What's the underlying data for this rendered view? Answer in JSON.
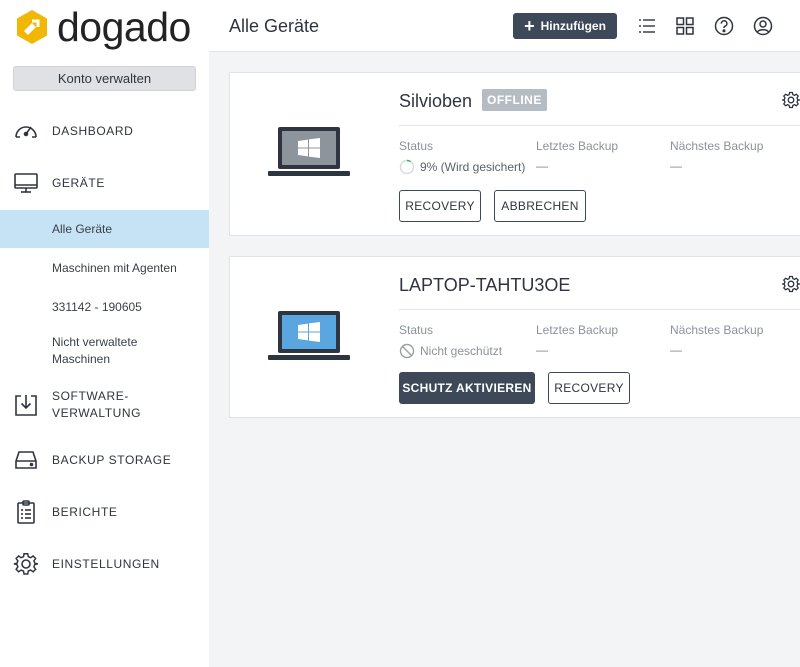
{
  "brand": {
    "name": "dogado",
    "accent": "#f2b705"
  },
  "sidebar": {
    "account_button": "Konto verwalten",
    "items": [
      {
        "label": "DASHBOARD",
        "icon": "speedometer-icon"
      },
      {
        "label": "GERÄTE",
        "icon": "monitor-icon"
      },
      {
        "label": "SOFTWARE-",
        "label2": "VERWALTUNG",
        "icon": "software-download-icon"
      },
      {
        "label": "BACKUP STORAGE",
        "icon": "storage-drive-icon"
      },
      {
        "label": "BERICHTE",
        "icon": "report-clipboard-icon"
      },
      {
        "label": "EINSTELLUNGEN",
        "icon": "gear-icon"
      }
    ],
    "subitems": [
      {
        "label": "Alle Geräte",
        "active": true
      },
      {
        "label": "Maschinen mit Agenten"
      },
      {
        "label": "331142 - 190605"
      },
      {
        "label": "Nicht verwaltete",
        "label2": "Maschinen"
      }
    ]
  },
  "header": {
    "title": "Alle Geräte",
    "add_button": "Hinzufügen",
    "icons": [
      "list-view-icon",
      "grid-view-icon",
      "help-icon",
      "user-account-icon"
    ]
  },
  "devices": [
    {
      "name": "Silvioben",
      "badge": "OFFLINE",
      "screen_color": "#8e949b",
      "status_label": "Status",
      "status_value": "9% (Wird gesichert)",
      "progress": 0.09,
      "last_backup_label": "Letztes Backup",
      "last_backup_value": "—",
      "next_backup_label": "Nächstes Backup",
      "next_backup_value": "—",
      "buttons": [
        "RECOVERY",
        "ABBRECHEN"
      ]
    },
    {
      "name": "LAPTOP-TAHTU3OE",
      "screen_color": "#5aa6e0",
      "status_label": "Status",
      "status_value": "Nicht geschützt",
      "last_backup_label": "Letztes Backup",
      "last_backup_value": "—",
      "next_backup_label": "Nächstes Backup",
      "next_backup_value": "—",
      "buttons": [
        "SCHUTZ AKTIVIEREN",
        "RECOVERY"
      ]
    }
  ]
}
